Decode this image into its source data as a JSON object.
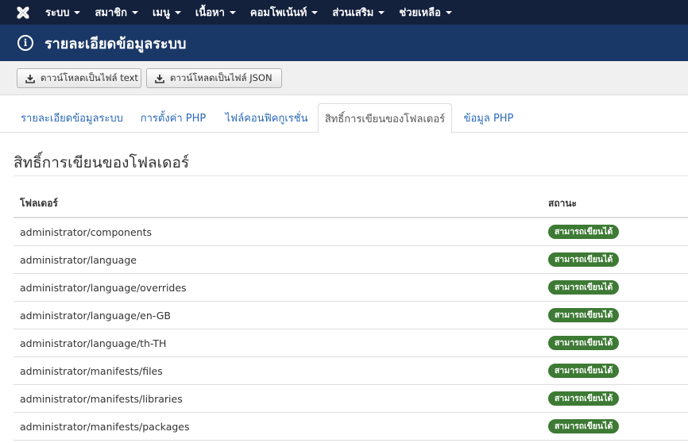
{
  "navbar": {
    "logo_icon": "joomla-logo-icon",
    "items": [
      {
        "label": "ระบบ"
      },
      {
        "label": "สมาชิก"
      },
      {
        "label": "เมนู"
      },
      {
        "label": "เนื้อหา"
      },
      {
        "label": "คอมโพเน้นท์"
      },
      {
        "label": "ส่วนเสริม"
      },
      {
        "label": "ช่วยเหลือ"
      }
    ]
  },
  "header": {
    "icon": "info-icon",
    "title": "รายละเอียดข้อมูลระบบ"
  },
  "toolbar": {
    "download_text_label": "ดาวน์โหลดเป็นไฟล์ text",
    "download_json_label": "ดาวน์โหลดเป็นไฟล์ JSON",
    "download_icon": "download-icon"
  },
  "tabs": [
    {
      "label": "รายละเอียดข้อมูลระบบ",
      "active": false
    },
    {
      "label": "การตั้งค่า PHP",
      "active": false
    },
    {
      "label": "ไฟล์คอนฟิคกูเรชั่น",
      "active": false
    },
    {
      "label": "สิทธิ์การเขียนของโฟลเดอร์",
      "active": true
    },
    {
      "label": "ข้อมูล PHP",
      "active": false
    }
  ],
  "section": {
    "title": "สิทธิ์การเขียนของโฟลเดอร์"
  },
  "table": {
    "headers": {
      "folder": "โฟลเดอร์",
      "status": "สถานะ"
    },
    "rows": [
      {
        "folder": "administrator/components",
        "status": "สามารถเขียนได้"
      },
      {
        "folder": "administrator/language",
        "status": "สามารถเขียนได้"
      },
      {
        "folder": "administrator/language/overrides",
        "status": "สามารถเขียนได้"
      },
      {
        "folder": "administrator/language/en-GB",
        "status": "สามารถเขียนได้"
      },
      {
        "folder": "administrator/language/th-TH",
        "status": "สามารถเขียนได้"
      },
      {
        "folder": "administrator/manifests/files",
        "status": "สามารถเขียนได้"
      },
      {
        "folder": "administrator/manifests/libraries",
        "status": "สามารถเขียนได้"
      },
      {
        "folder": "administrator/manifests/packages",
        "status": "สามารถเขียนได้"
      }
    ]
  },
  "colors": {
    "navbar_bg": "#14213d",
    "header_bg": "#1a3867",
    "link": "#2a69b8",
    "badge_success": "#3d7a34"
  }
}
